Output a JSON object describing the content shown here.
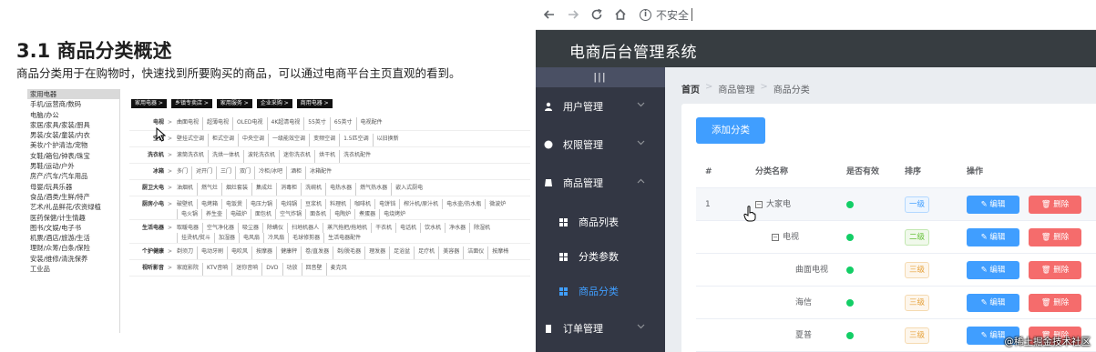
{
  "document": {
    "title": "3.1 商品分类概述",
    "intro": "商品分类用于在购物时，快速找到所要购买的商品，可以通过电商平台主页直观的看到。",
    "categories": [
      "家用电器",
      "手机/运营商/数码",
      "电脑/办公",
      "家居/家具/家装/厨具",
      "男装/女装/童装/内衣",
      "美妆/个护清洁/宠物",
      "女鞋/箱包/钟表/珠宝",
      "男鞋/运动/户外",
      "房产/汽车/汽车用品",
      "母婴/玩具乐器",
      "食品/酒类/生鲜/特产",
      "艺术/礼品鲜花/农资绿植",
      "医药保健/计生情趣",
      "图书/文娱/电子书",
      "机票/酒店/旅游/生活",
      "理财/众筹/白条/保险",
      "安装/维修/清洗保养",
      "工业品"
    ],
    "tabs": [
      "家用电器 >",
      "乡镇专卖店 >",
      "家用服务 >",
      "企业采购 >",
      "商用电器 >"
    ],
    "rows": [
      {
        "label": "电视",
        "items": [
          "曲面电视",
          "超薄电视",
          "OLED电视",
          "4K超清电视",
          "55英寸",
          "65英寸",
          "电视配件"
        ]
      },
      {
        "label": "空调",
        "items": [
          "壁挂式空调",
          "柜式空调",
          "中央空调",
          "一级能效空调",
          "变频空调",
          "1.5匹空调",
          "以旧换新"
        ]
      },
      {
        "label": "洗衣机",
        "items": [
          "滚筒洗衣机",
          "洗烘一体机",
          "波轮洗衣机",
          "迷你洗衣机",
          "烘干机",
          "洗衣机配件"
        ]
      },
      {
        "label": "冰箱",
        "items": [
          "多门",
          "对开门",
          "三门",
          "双门",
          "冷柜/冰吧",
          "酒柜",
          "冰箱配件"
        ]
      },
      {
        "label": "厨卫大电",
        "items": [
          "油烟机",
          "燃气灶",
          "烟灶套装",
          "集成灶",
          "消毒柜",
          "洗碗机",
          "电热水器",
          "燃气热水器",
          "嵌入式厨电"
        ]
      },
      {
        "label": "厨房小电",
        "items": [
          "破壁机",
          "电烤箱",
          "电饭煲",
          "电压力锅",
          "电炖锅",
          "豆浆机",
          "料理机",
          "咖啡机",
          "电饼铛",
          "榨汁机/原汁机",
          "电水壶/热水瓶",
          "微波炉",
          "电火锅",
          "养生壶",
          "电磁炉",
          "面包机",
          "空气炸锅",
          "面条机",
          "电陶炉",
          "煮蛋器",
          "电烧烤炉"
        ]
      },
      {
        "label": "生活电器",
        "items": [
          "取暖电器",
          "空气净化器",
          "吸尘器",
          "除螨仪",
          "扫地机器人",
          "蒸汽拖把/拖地机",
          "干衣机",
          "电话机",
          "饮水机",
          "净水器",
          "除湿机",
          "挂烫机/熨斗",
          "加湿器",
          "电风扇",
          "冷风扇",
          "毛球修剪器",
          "生活电器配件"
        ]
      },
      {
        "label": "个护健康",
        "items": [
          "剃须刀",
          "电动牙刷",
          "电吹风",
          "按摩器",
          "健康秤",
          "卷/直发器",
          "剃/脱毛器",
          "理发器",
          "足浴盆",
          "足疗机",
          "美容器",
          "洁面仪",
          "按摩椅"
        ]
      },
      {
        "label": "视听影音",
        "items": [
          "家庭影院",
          "KTV音响",
          "迷你音响",
          "DVD",
          "功放",
          "回音壁",
          "麦克风"
        ]
      }
    ]
  },
  "browser": {
    "security_label": "不安全",
    "app_title": "电商后台管理系统",
    "collapse_label": "|||",
    "menu": [
      {
        "label": "用户管理",
        "icon": "user-icon"
      },
      {
        "label": "权限管理",
        "icon": "lock-icon"
      },
      {
        "label": "商品管理",
        "icon": "goods-icon"
      },
      {
        "label": "订单管理",
        "icon": "order-icon"
      }
    ],
    "submenu": [
      {
        "label": "商品列表",
        "active": false
      },
      {
        "label": "分类参数",
        "active": false
      },
      {
        "label": "商品分类",
        "active": true
      }
    ],
    "breadcrumb": [
      "首页",
      "商品管理",
      "商品分类"
    ],
    "add_button": "添加分类",
    "table": {
      "headers": [
        "#",
        "分类名称",
        "是否有效",
        "排序",
        "操作"
      ],
      "rows": [
        {
          "index": "1",
          "name": "大家电",
          "toggle": "⊟",
          "level": "一级",
          "level_class": "lvl-1"
        },
        {
          "index": "",
          "name": "电视",
          "toggle": "⊟",
          "level": "二级",
          "level_class": "lvl-2"
        },
        {
          "index": "",
          "name": "曲面电视",
          "toggle": "",
          "level": "三级",
          "level_class": "lvl-3"
        },
        {
          "index": "",
          "name": "海信",
          "toggle": "",
          "level": "三级",
          "level_class": "lvl-3"
        },
        {
          "index": "",
          "name": "夏普",
          "toggle": "",
          "level": "三级",
          "level_class": "lvl-3"
        }
      ],
      "edit_label": "编辑",
      "delete_label": "删除"
    },
    "watermark": "@稀土掘金技术社区"
  },
  "colors": {
    "header_bg": "#373d41",
    "sidebar_bg": "#333744",
    "primary": "#409eff",
    "danger": "#f56c6c",
    "success": "#13ce66"
  }
}
